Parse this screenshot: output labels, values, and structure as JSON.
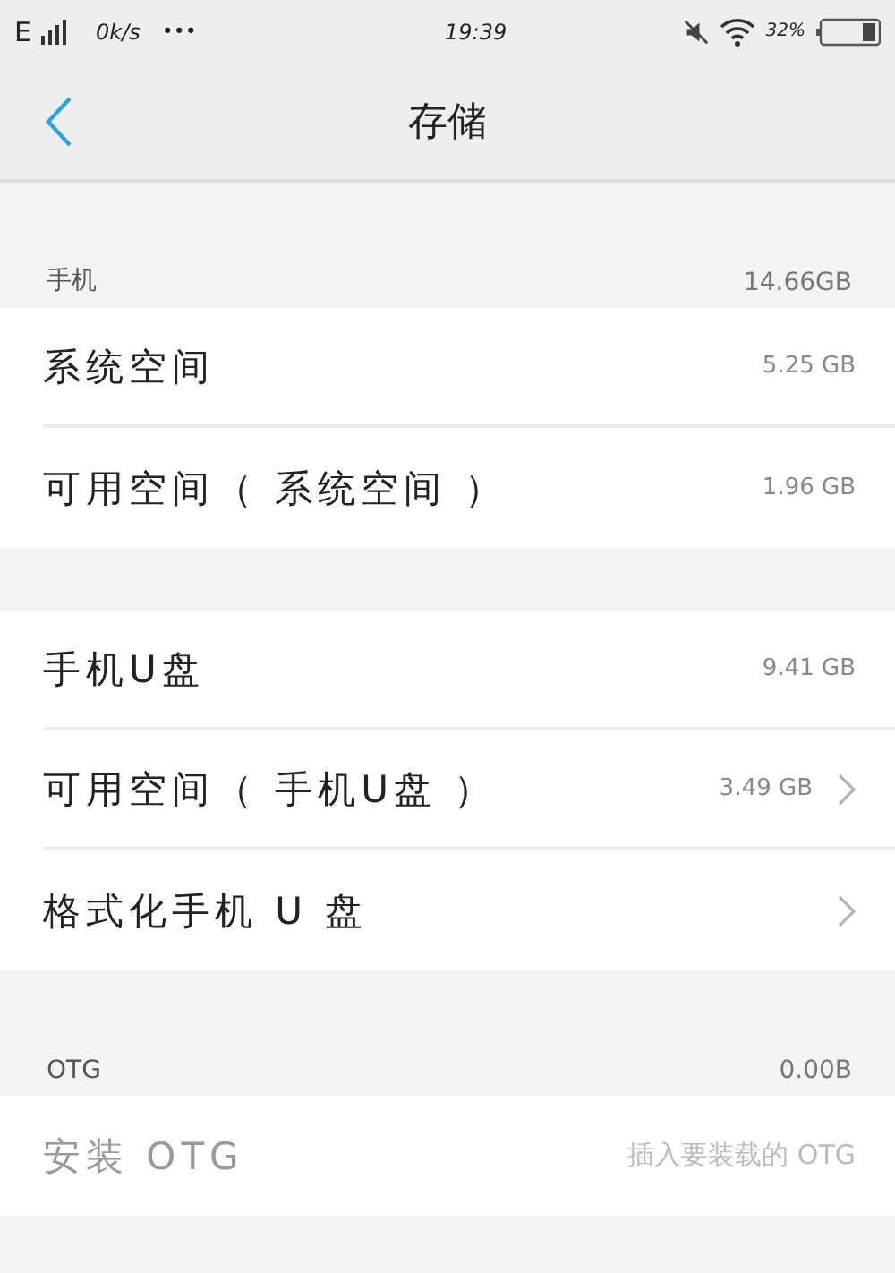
{
  "status_bar": {
    "network": "E",
    "speed": "0k/s",
    "more": "•••",
    "time": "19:39",
    "battery": "32%"
  },
  "nav": {
    "title": "存储"
  },
  "sections": [
    {
      "header": {
        "label": "手机",
        "value": "14.66GB"
      },
      "rows": [
        {
          "label": "系统空间",
          "value": "5.25 GB",
          "chevron": false,
          "disabled": false
        },
        {
          "label": "可用空间（ 系统空间 ）",
          "value": "1.96 GB",
          "chevron": false,
          "disabled": false
        }
      ]
    },
    {
      "rows": [
        {
          "label": "手机U盘",
          "value": "9.41 GB",
          "chevron": false,
          "disabled": false
        },
        {
          "label": "可用空间（ 手机U盘 ）",
          "value": "3.49 GB",
          "chevron": true,
          "disabled": false
        },
        {
          "label": "格式化手机 U 盘",
          "chevron": true,
          "disabled": false
        }
      ]
    },
    {
      "header": {
        "label": "OTG",
        "value": "0.00B"
      },
      "rows": [
        {
          "label": "安装 OTG",
          "value": "插入要装载的 OTG",
          "chevron": false,
          "disabled": true
        }
      ]
    }
  ]
}
